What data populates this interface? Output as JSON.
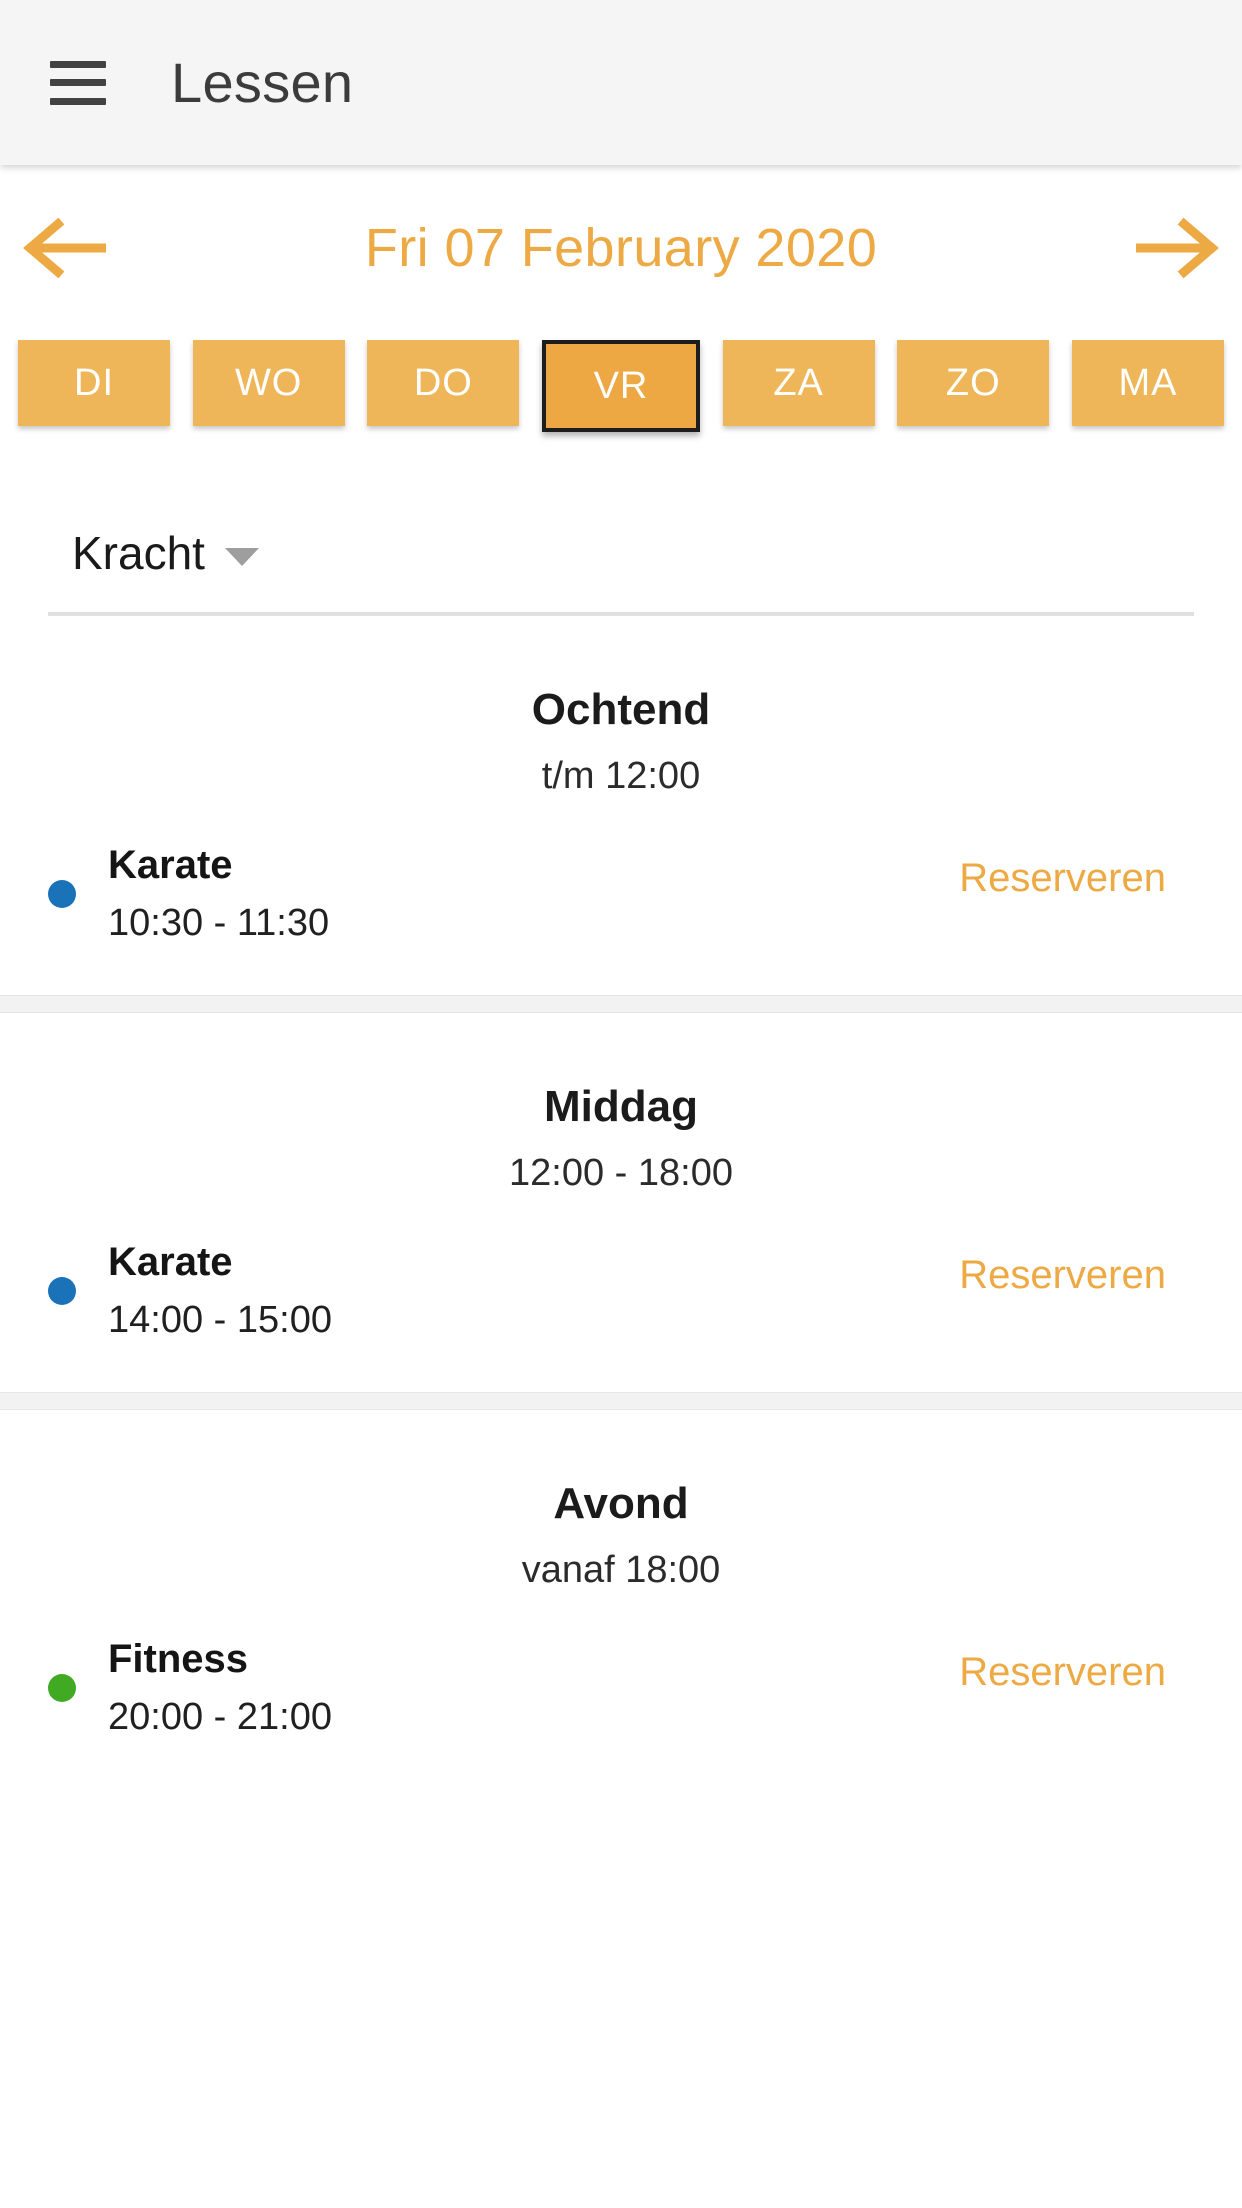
{
  "appbar": {
    "menu_icon": "hamburger-menu-icon",
    "title": "Lessen"
  },
  "date_nav": {
    "prev_icon": "arrow-left-icon",
    "next_icon": "arrow-right-icon",
    "current_date": "Fri 07 February 2020"
  },
  "days": [
    {
      "label": "DI",
      "selected": false
    },
    {
      "label": "WO",
      "selected": false
    },
    {
      "label": "DO",
      "selected": false
    },
    {
      "label": "VR",
      "selected": true
    },
    {
      "label": "ZA",
      "selected": false
    },
    {
      "label": "ZO",
      "selected": false
    },
    {
      "label": "MA",
      "selected": false
    }
  ],
  "filter": {
    "selected": "Kracht",
    "caret_icon": "caret-down-icon"
  },
  "sections": [
    {
      "title": "Ochtend",
      "subtitle": "t/m 12:00",
      "lessons": [
        {
          "name": "Karate",
          "time": "10:30 - 11:30",
          "dot_color": "#1a73b8",
          "action": "Reserveren"
        }
      ]
    },
    {
      "title": "Middag",
      "subtitle": "12:00 - 18:00",
      "lessons": [
        {
          "name": "Karate",
          "time": "14:00 - 15:00",
          "dot_color": "#1a73b8",
          "action": "Reserveren"
        }
      ]
    },
    {
      "title": "Avond",
      "subtitle": "vanaf 18:00",
      "lessons": [
        {
          "name": "Fitness",
          "time": "20:00 - 21:00",
          "dot_color": "#3faa22",
          "action": "Reserveren"
        }
      ]
    }
  ],
  "colors": {
    "accent_orange": "#eda944",
    "chip_orange": "#efb659",
    "chip_orange_selected": "#eda843",
    "appbar_bg": "#f5f5f5",
    "divider": "#e0e0e0"
  }
}
